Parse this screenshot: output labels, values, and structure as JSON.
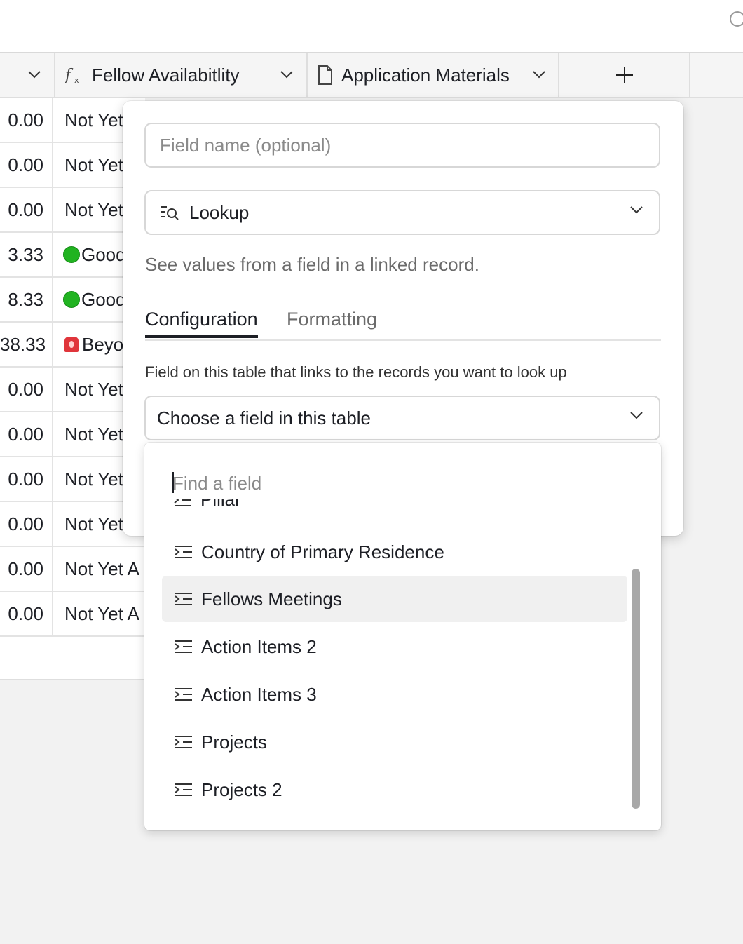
{
  "header": {
    "columns": [
      {
        "label": "Fellow Availabitlity",
        "icon": "formula-icon"
      },
      {
        "label": "Application Materials",
        "icon": "document-icon"
      }
    ],
    "add_label": "+"
  },
  "rows": [
    {
      "value": "0.00",
      "status": "Not Yet"
    },
    {
      "value": "0.00",
      "status": "Not Yet"
    },
    {
      "value": "0.00",
      "status": "Not Yet"
    },
    {
      "value": "3.33",
      "status": "Good",
      "icon": "green-circle"
    },
    {
      "value": "8.33",
      "status": "Good",
      "icon": "green-circle"
    },
    {
      "value": "38.33",
      "status": "Beyo",
      "icon": "siren"
    },
    {
      "value": "0.00",
      "status": "Not Yet"
    },
    {
      "value": "0.00",
      "status": "Not Yet"
    },
    {
      "value": "0.00",
      "status": "Not Yet"
    },
    {
      "value": "0.00",
      "status": "Not Yet"
    },
    {
      "value": "0.00",
      "status": "Not Yet A"
    },
    {
      "value": "0.00",
      "status": "Not Yet A"
    }
  ],
  "panel": {
    "field_name_placeholder": "Field name (optional)",
    "field_type": "Lookup",
    "description": "See values from a field in a linked record.",
    "tabs": [
      "Configuration",
      "Formatting"
    ],
    "help": "Field on this table that links to the records you want to look up",
    "link_field_select": "Choose a field in this table"
  },
  "dropdown": {
    "search_placeholder": "Find a field",
    "partial_item": "Pillar",
    "items": [
      "Country of Primary Residence",
      "Fellows Meetings",
      "Action Items 2",
      "Action Items 3",
      "Projects",
      "Projects 2"
    ],
    "hover_index": 1
  }
}
